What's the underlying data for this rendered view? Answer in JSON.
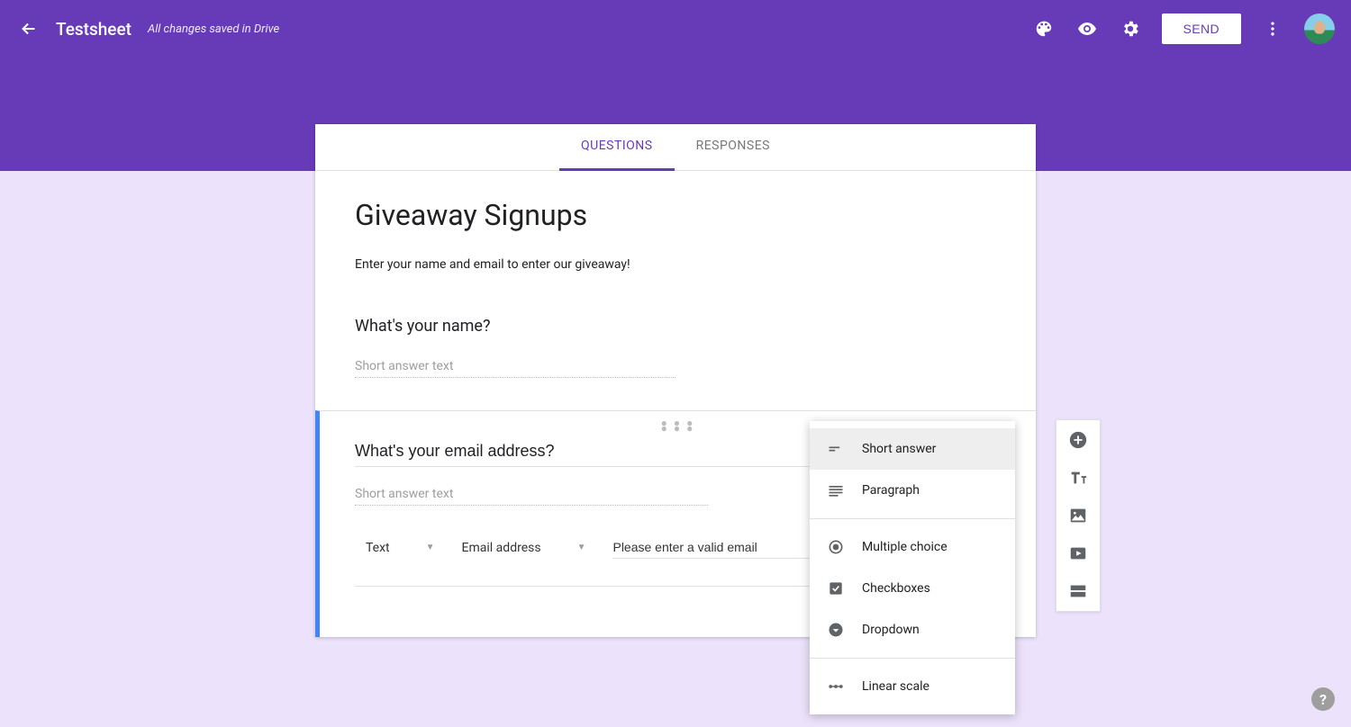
{
  "header": {
    "doc_title": "Testsheet",
    "save_status": "All changes saved in Drive",
    "send_label": "SEND"
  },
  "tabs": {
    "questions": "QUESTIONS",
    "responses": "RESPONSES"
  },
  "form": {
    "title": "Giveaway Signups",
    "description": "Enter your name and email to enter our giveaway!"
  },
  "question1": {
    "title": "What's your name?",
    "placeholder": "Short answer text"
  },
  "question2": {
    "title": "What's your email address?",
    "placeholder": "Short answer text",
    "validation": {
      "type": "Text",
      "subtype": "Email address",
      "error_text": "Please enter a valid email"
    }
  },
  "type_menu": {
    "short_answer": "Short answer",
    "paragraph": "Paragraph",
    "multiple_choice": "Multiple choice",
    "checkboxes": "Checkboxes",
    "dropdown": "Dropdown",
    "linear_scale": "Linear scale"
  },
  "help": {
    "glyph": "?"
  }
}
